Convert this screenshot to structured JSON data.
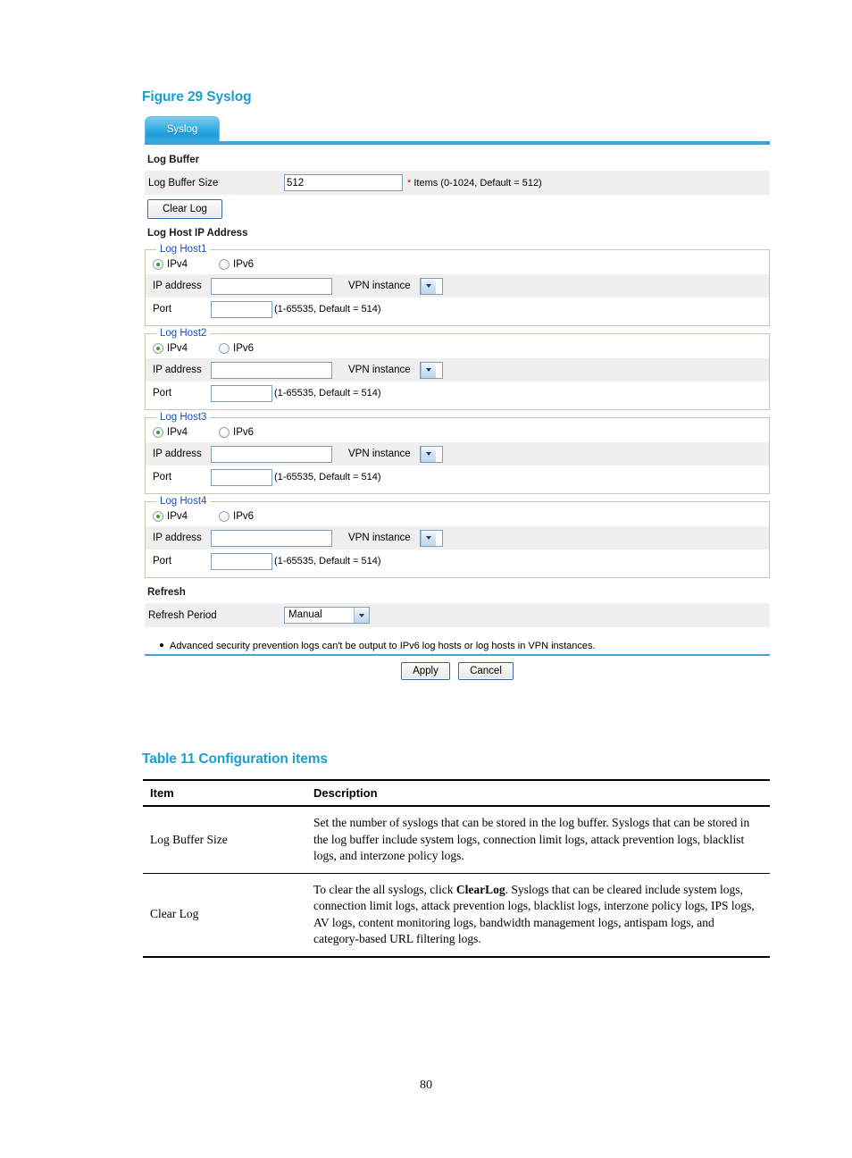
{
  "figure": {
    "caption": "Figure 29 Syslog"
  },
  "tab": {
    "label": "Syslog"
  },
  "log_buffer": {
    "section_title": "Log Buffer",
    "size_label": "Log Buffer Size",
    "size_value": "512",
    "size_hint_star": "*",
    "size_hint": "Items (0-1024, Default = 512)",
    "clear_log_button": "Clear Log"
  },
  "log_host": {
    "section_title": "Log Host IP Address",
    "ipv4_label": "IPv4",
    "ipv6_label": "IPv6",
    "ip_label": "IP address",
    "vpn_label": "VPN instance",
    "vpn_value": "",
    "port_label": "Port",
    "port_hint": "(1-65535, Default = 514)",
    "ip_value": "",
    "port_value": "",
    "hosts": [
      {
        "legend": "Log Host1",
        "selected": "IPv4"
      },
      {
        "legend": "Log Host2",
        "selected": "IPv4"
      },
      {
        "legend": "Log Host3",
        "selected": "IPv4"
      },
      {
        "legend": "Log Host4",
        "selected": "IPv4"
      }
    ]
  },
  "refresh": {
    "section_title": "Refresh",
    "period_label": "Refresh Period",
    "period_value": "Manual"
  },
  "note": {
    "text": "Advanced security prevention logs can't be output to IPv6 log hosts or log hosts in VPN instances."
  },
  "actions": {
    "apply_label": "Apply",
    "cancel_label": "Cancel"
  },
  "table": {
    "caption": "Table 11 Configuration items",
    "headers": [
      "Item",
      "Description"
    ],
    "rows": [
      {
        "item": "Log Buffer Size",
        "description": "Set the number of syslogs that can be stored in the log buffer. Syslogs that can be stored in the log buffer include system logs, connection limit logs, attack prevention logs, blacklist logs, and interzone policy logs."
      },
      {
        "item": "Clear Log",
        "desc_prefix": "To clear the all syslogs, click ",
        "desc_bold": "ClearLog",
        "desc_suffix": ". Syslogs that can be cleared include system logs, connection limit logs, attack prevention logs, blacklist logs, interzone policy logs, IPS logs, AV logs, content monitoring logs, bandwidth management logs, antispam logs, and category-based URL filtering logs."
      }
    ]
  },
  "footer": {
    "page_number": "80"
  },
  "colors": {
    "caption": "#18a0d0",
    "tab_blue": "#34a7de",
    "legend_blue": "#1f4eb4",
    "required_star": "#d0021b",
    "row_gray": "#efefef"
  }
}
